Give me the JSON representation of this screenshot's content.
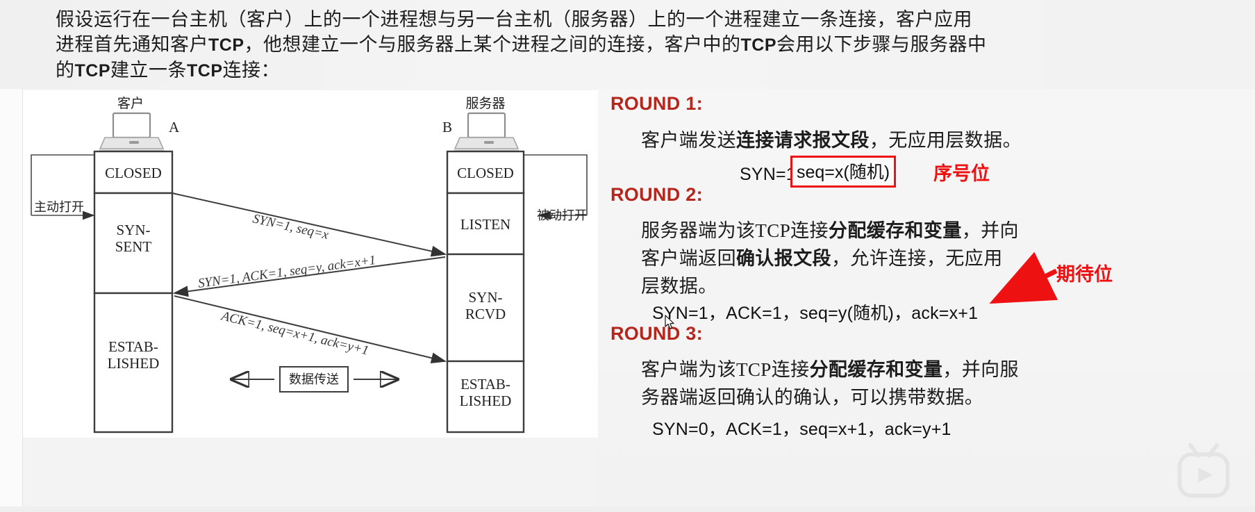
{
  "header": {
    "line1": "假设运行在一台主机（客户）上的一个进程想与另一台主机（服务器）上的一个进程建立一条连接，客户应用",
    "line2_a": "进程首先通知客户",
    "line2_tcp": "TCP",
    "line2_b": "，他想建立一个与服务器上某个进程之间的连接，客户中的",
    "line2_tcp2": "TCP",
    "line2_c": "会用以下步骤与服务器中",
    "line3_a": "的",
    "line3_tcp": "TCP",
    "line3_b": "建立一条",
    "line3_tcp2": "TCP",
    "line3_c": "连接："
  },
  "diagram": {
    "client_title": "客户",
    "client_letter": "A",
    "server_title": "服务器",
    "server_letter": "B",
    "active_open": "主动打开",
    "passive_open": "被动打开",
    "client_states": [
      "CLOSED",
      "SYN-\nSENT",
      "ESTAB-\nLISHED"
    ],
    "client_state_1": "CLOSED",
    "client_state_2a": "SYN-",
    "client_state_2b": "SENT",
    "client_state_3a": "ESTAB-",
    "client_state_3b": "LISHED",
    "server_state_1": "CLOSED",
    "server_state_2": "LISTEN",
    "server_state_3a": "SYN-",
    "server_state_3b": "RCVD",
    "server_state_4a": "ESTAB-",
    "server_state_4b": "LISHED",
    "msg1": "SYN=1, seq=x",
    "msg2": "SYN=1, ACK=1, seq=y, ack=x+1",
    "msg3": "ACK=1, seq=x+1, ack=y+1",
    "data_transfer": "数据传送"
  },
  "rounds": [
    {
      "head": "ROUND 1:",
      "desc_a": "客户端发送",
      "desc_b": "连接请求报文段",
      "desc_c": "，无应用层数据。",
      "flags_prefix": "SYN=1，",
      "boxed": "seq=x(随机)",
      "annotation": "序号位"
    },
    {
      "head": "ROUND 2:",
      "desc_l1_a": "服务器端为该TCP连接",
      "desc_l1_b": "分配缓存和变量",
      "desc_l1_c": "，并向",
      "desc_l2_a": "客户端返回",
      "desc_l2_b": "确认报文段",
      "desc_l2_c": "，允许连接，无应用",
      "desc_l3": "层数据。",
      "flags": "SYN=1，ACK=1，seq=y(随机)，ack=x+1",
      "annotation": "期待位"
    },
    {
      "head": "ROUND 3:",
      "desc_l1_a": "客户端为该TCP连接",
      "desc_l1_b": "分配缓存和变量",
      "desc_l1_c": "，并向服",
      "desc_l2": "务器端返回确认的确认，可以携带数据。",
      "flags": "SYN=0，ACK=1，seq=x+1，ack=y+1"
    }
  ],
  "colors": {
    "round_red": "#b5261d",
    "annotation_red": "#ee1111",
    "box_red": "#ee1111",
    "diagram_line": "#4a4a4a",
    "text": "#1d1d1d"
  }
}
